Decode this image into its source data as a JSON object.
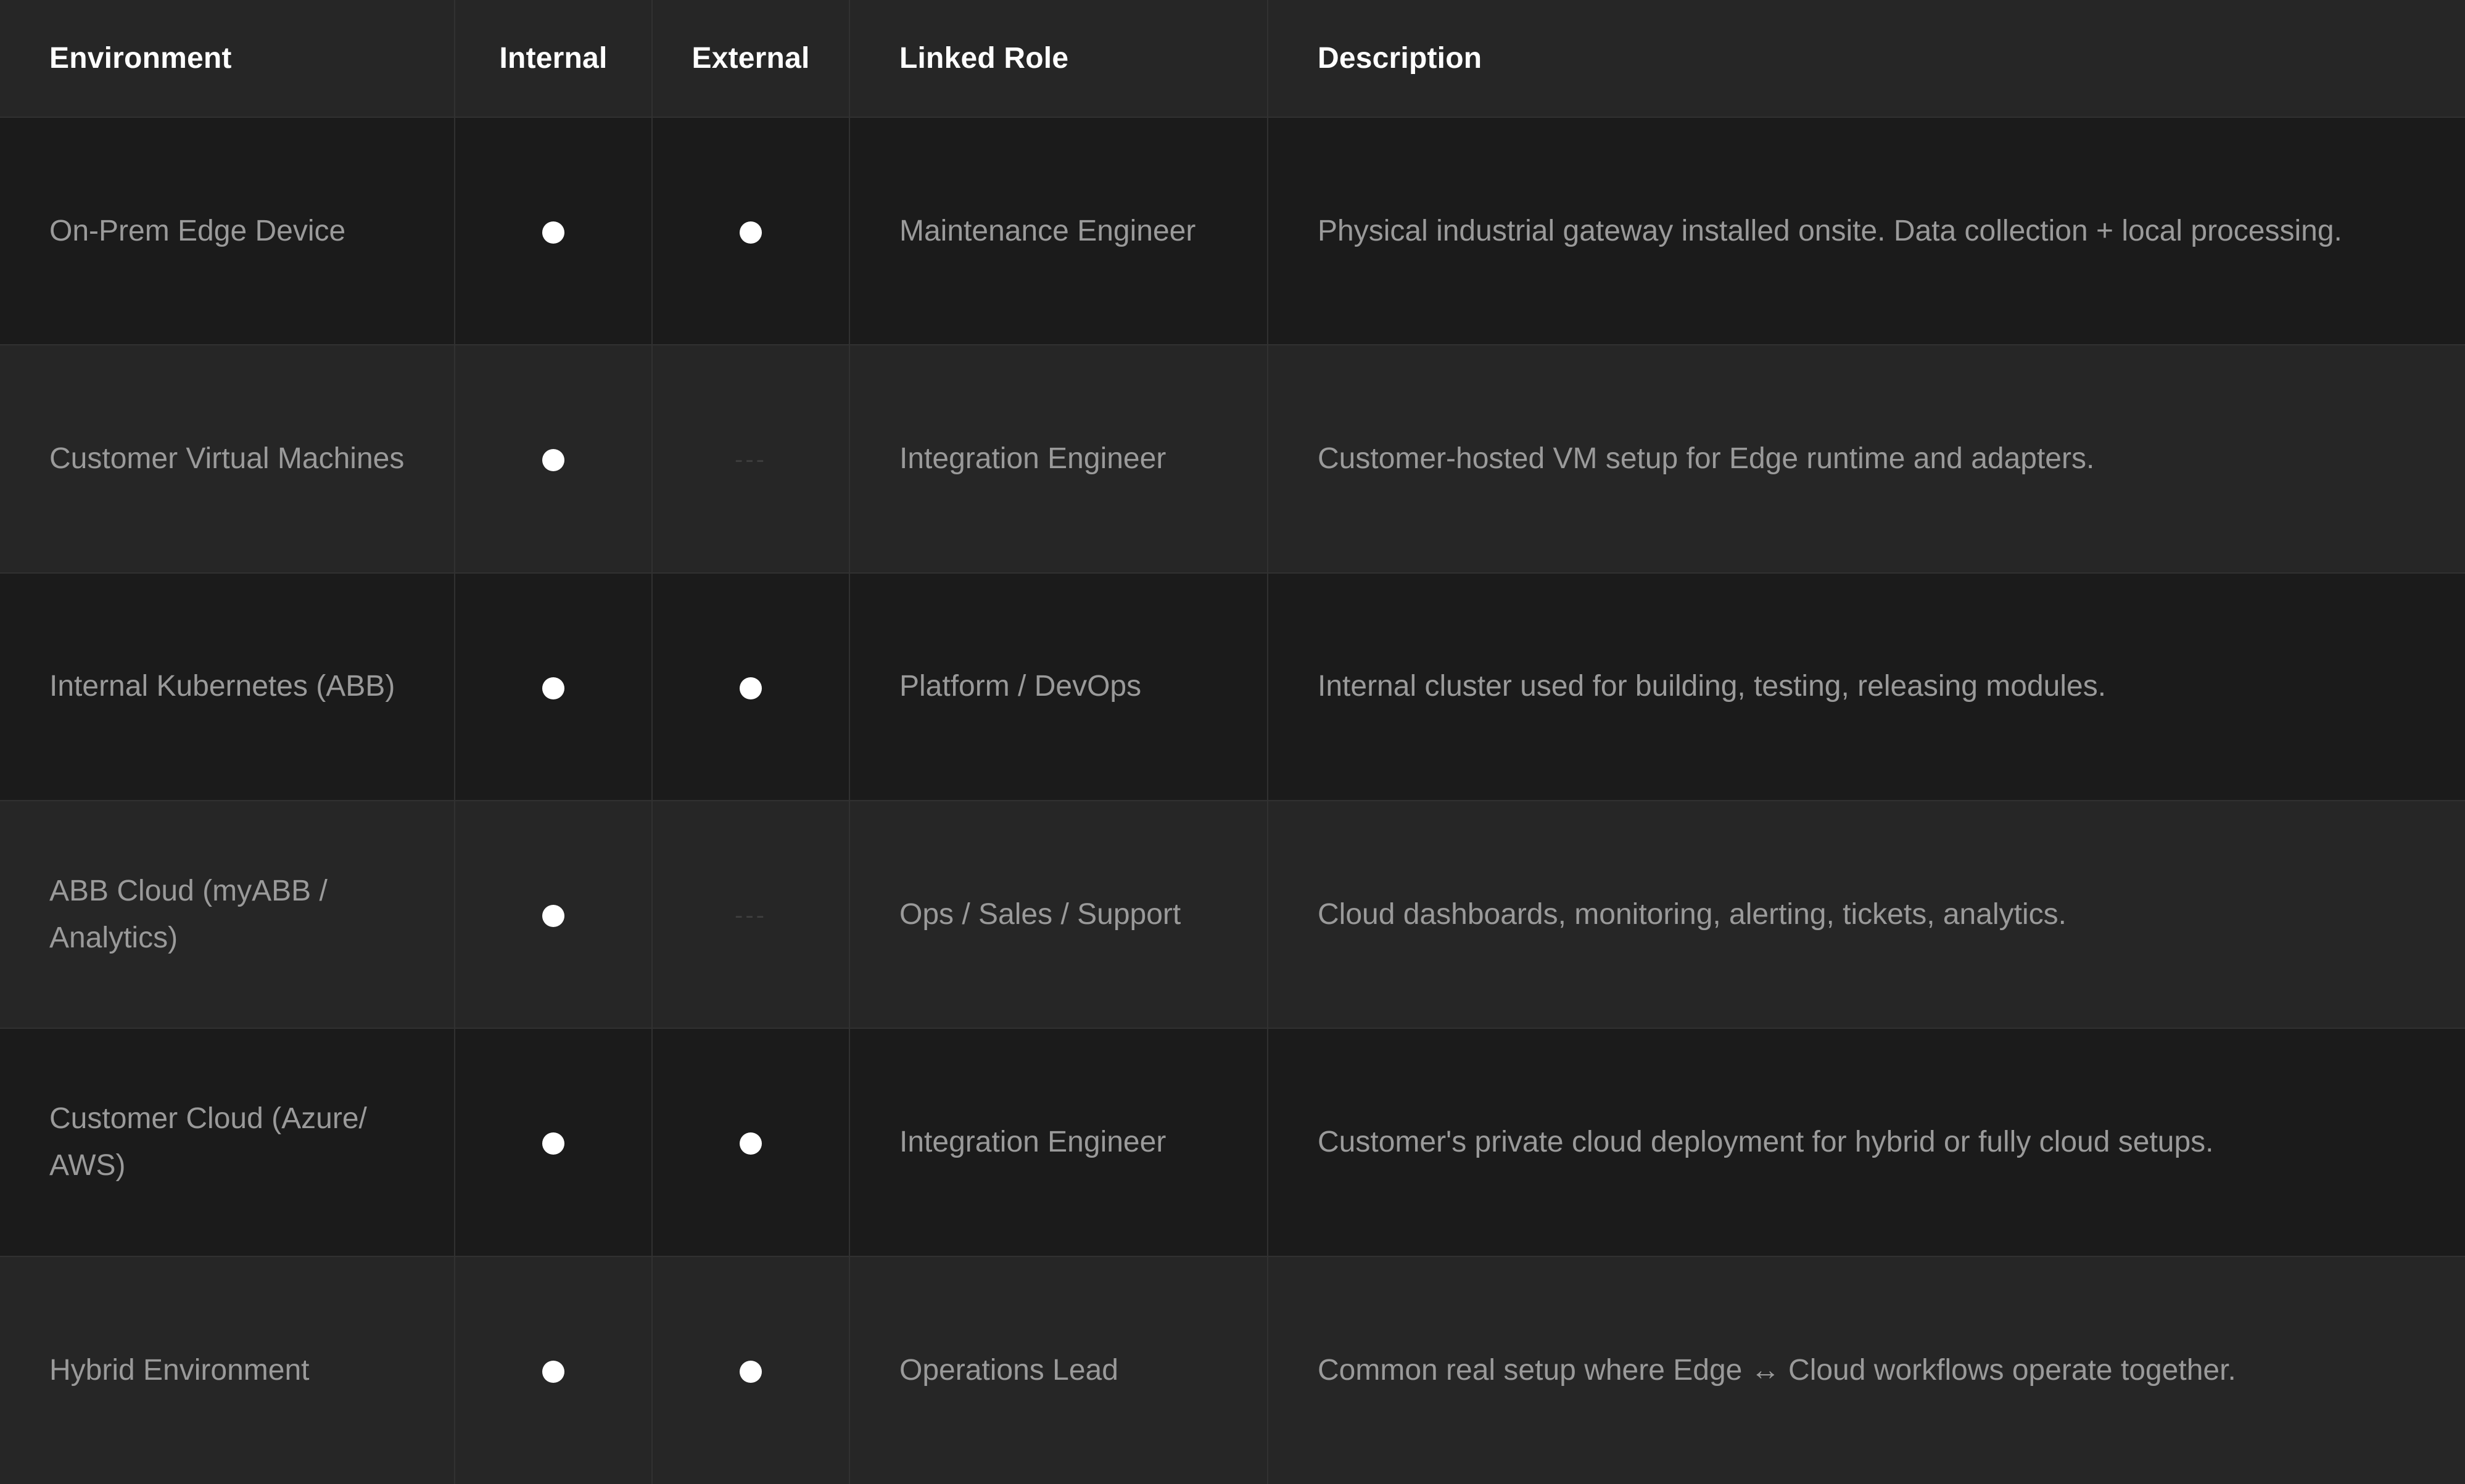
{
  "table": {
    "headers": {
      "environment": "Environment",
      "internal": "Internal",
      "external": "External",
      "linked_role": "Linked Role",
      "description": "Description"
    },
    "rows": [
      {
        "environment": "On-Prem Edge Device",
        "internal": true,
        "external": true,
        "linked_role": "Maintenance Engineer",
        "description": "Physical industrial gateway installed onsite. Data collection + local processing."
      },
      {
        "environment": "Customer Virtual Machines",
        "internal": true,
        "external": false,
        "linked_role": "Integration Engineer",
        "description": "Customer-hosted VM setup for Edge runtime and adapters."
      },
      {
        "environment": "Internal Kubernetes (ABB)",
        "internal": true,
        "external": true,
        "linked_role": "Platform / DevOps",
        "description": "Internal cluster used for building, testing, releasing modules."
      },
      {
        "environment": "ABB Cloud (myABB / Analytics)",
        "internal": true,
        "external": false,
        "linked_role": "Ops / Sales / Support",
        "description": "Cloud dashboards, monitoring, alerting, tickets, analytics."
      },
      {
        "environment": "Customer Cloud (Azure/ AWS)",
        "internal": true,
        "external": true,
        "linked_role": "Integration Engineer",
        "description": "Customer's private cloud deployment for hybrid or fully cloud setups."
      },
      {
        "environment": "Hybrid Environment",
        "internal": true,
        "external": true,
        "linked_role": "Operations Lead",
        "description": "Common real setup where Edge ↔ Cloud workflows operate together."
      }
    ],
    "empty_marker": "---",
    "colors": {
      "header_bg": "#262626",
      "row_dark": "#1b1b1b",
      "row_light": "#262626",
      "header_text": "#ffffff",
      "cell_text": "#9a9a9a",
      "dot": "#ffffff",
      "grid_line": "#313131"
    }
  }
}
